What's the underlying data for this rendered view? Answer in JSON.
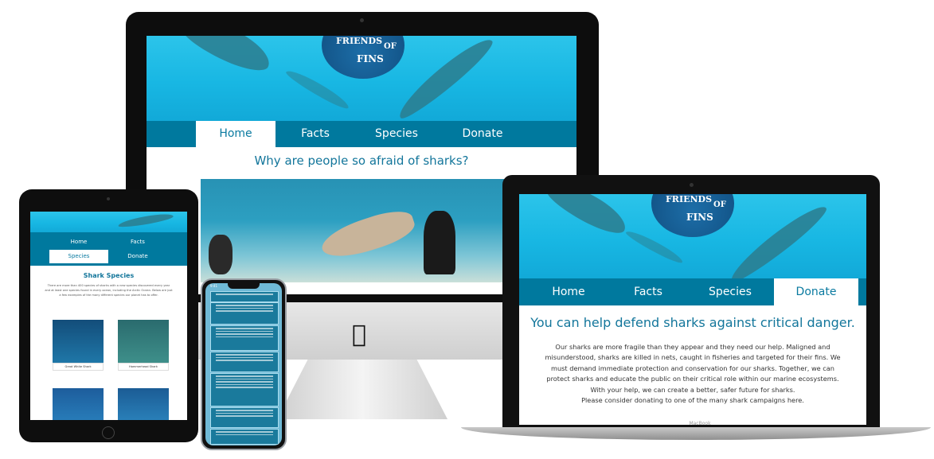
{
  "imac": {
    "logo_line1": "FRIENDS",
    "logo_line2": "OF",
    "logo_line3": "FINS",
    "nav": [
      {
        "label": "Home",
        "active": true
      },
      {
        "label": "Facts",
        "active": false
      },
      {
        "label": "Species",
        "active": false
      },
      {
        "label": "Donate",
        "active": false
      }
    ],
    "heading": "Why are people so afraid of sharks?"
  },
  "macbook": {
    "logo_line1": "FRIENDS",
    "logo_line2": "OF",
    "logo_line3": "FINS",
    "nav": [
      {
        "label": "Home",
        "active": false
      },
      {
        "label": "Facts",
        "active": false
      },
      {
        "label": "Species",
        "active": false
      },
      {
        "label": "Donate",
        "active": true
      }
    ],
    "heading": "You can help defend sharks against critical danger.",
    "paragraph": "Our sharks are more fragile than they appear and they need our help. Maligned and misunderstood, sharks are killed in nets, caught in fisheries and targeted for their fins. We must demand immediate protection and conservation for our sharks. Together, we can protect sharks and educate the public on their critical role within our marine ecosystems. With your help, we can create a better, safer future for sharks.",
    "paragraph2": "Please consider donating to one of the many shark campaigns here.",
    "brand": "MacBook"
  },
  "ipad": {
    "nav": [
      {
        "label": "Home",
        "active": false
      },
      {
        "label": "Facts",
        "active": false
      },
      {
        "label": "Species",
        "active": true
      },
      {
        "label": "Donate",
        "active": false
      }
    ],
    "heading": "Shark Species",
    "paragraph": "There are more than 400 species of sharks with a new species discovered every year and at least one species found in every ocean, including the Arctic Ocean. Below are just a few examples of the many different species our planet has to offer.",
    "cards": [
      "Great White Shark",
      "Hammerhead Shark"
    ]
  },
  "iphone": {
    "time": "9:41"
  },
  "colors": {
    "nav_bg": "#00799e",
    "heading": "#13769b",
    "ocean": "#18b7e3"
  }
}
